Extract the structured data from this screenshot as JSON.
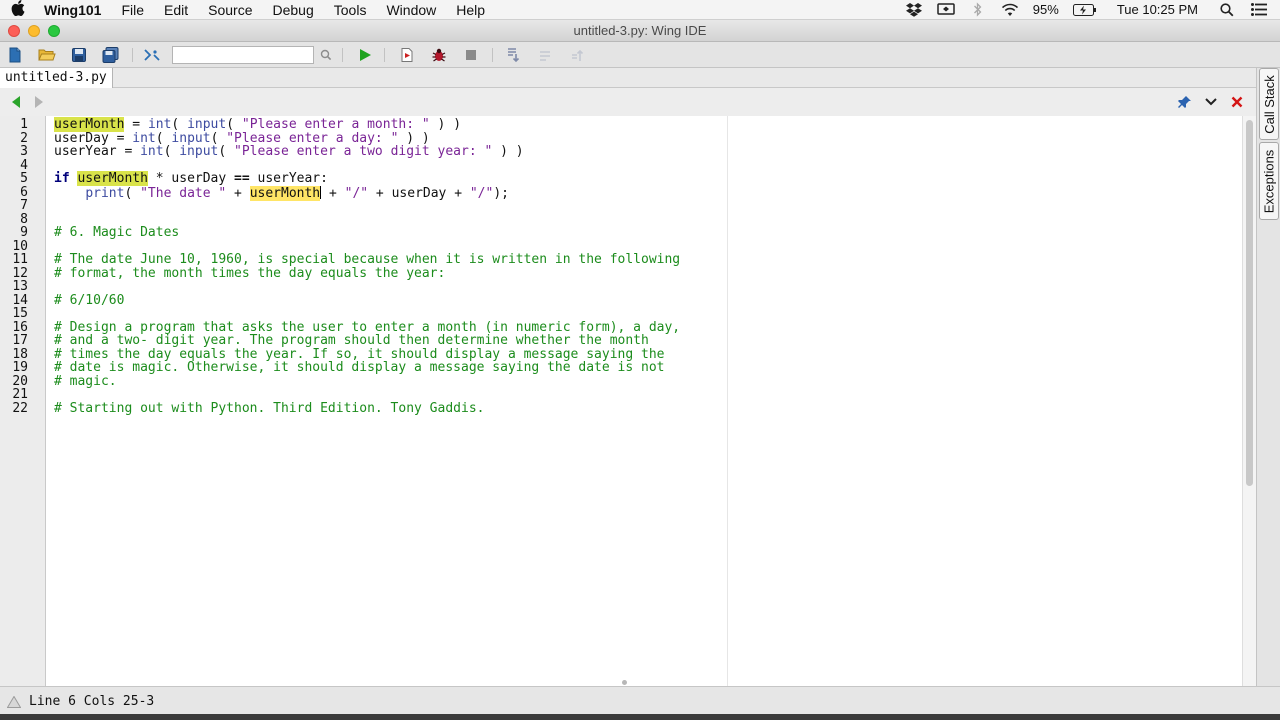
{
  "menubar": {
    "app_name": "Wing101",
    "items": [
      "File",
      "Edit",
      "Source",
      "Debug",
      "Tools",
      "Window",
      "Help"
    ],
    "battery": "95%",
    "clock": "Tue 10:25 PM"
  },
  "window": {
    "title": "untitled-3.py: Wing IDE"
  },
  "toolbar": {
    "search_value": ""
  },
  "tabs": [
    {
      "label": "untitled-3.py",
      "active": true
    }
  ],
  "side_panels": [
    "Call Stack",
    "Exceptions"
  ],
  "editor": {
    "line_numbers": [
      "1",
      "2",
      "3",
      "4",
      "5",
      "6",
      "7",
      "8",
      "9",
      "10",
      "11",
      "12",
      "13",
      "14",
      "15",
      "16",
      "17",
      "18",
      "19",
      "20",
      "21",
      "22"
    ],
    "lines": {
      "l1": {
        "a": "userMonth",
        "b": " = ",
        "c": "int",
        "d": "( ",
        "e": "input",
        "f": "( ",
        "g": "\"Please enter a month: \"",
        "h": " ) )"
      },
      "l2": {
        "a": "userDay = ",
        "b": "int",
        "c": "( ",
        "d": "input",
        "e": "( ",
        "f": "\"Please enter a day: \"",
        "g": " ) )"
      },
      "l3": {
        "a": "userYear = ",
        "b": "int",
        "c": "( ",
        "d": "input",
        "e": "( ",
        "f": "\"Please enter a two digit year: \"",
        "g": " ) )"
      },
      "l5": {
        "a": "if",
        "b": " ",
        "c": "userMonth",
        "d": " * userDay ",
        "e": "==",
        "f": " userYear:"
      },
      "l6": {
        "a": "    ",
        "b": "print",
        "c": "( ",
        "d": "\"The date \"",
        "e": " + ",
        "f": "userMonth",
        "g": " + ",
        "h": "\"/\"",
        "i": " + userDay + ",
        "j": "\"/\"",
        "k": ");"
      },
      "l9": "# 6. Magic Dates",
      "l11": "# The date June 10, 1960, is special because when it is written in the following",
      "l12": "# format, the month times the day equals the year:",
      "l14": "# 6/10/60",
      "l16": "# Design a program that asks the user to enter a month (in numeric form), a day,",
      "l17": "# and a two- digit year. The program should then determine whether the month",
      "l18": "# times the day equals the year. If so, it should display a message saying the",
      "l19": "# date is magic. Otherwise, it should display a message saying the date is not",
      "l20": "# magic.",
      "l22": "# Starting out with Python. Third Edition. Tony Gaddis."
    }
  },
  "status": {
    "position": "Line 6 Cols 25-3"
  },
  "colors": {
    "keyword": "#00007a",
    "builtin": "#3d4ba0",
    "string": "#7a2496",
    "comment": "#1c8c1c",
    "highlight": "#d9e34a"
  },
  "icons": [
    "apple-icon",
    "dropbox-icon",
    "screen-mirror-icon",
    "bluetooth-icon",
    "wifi-icon",
    "battery-icon",
    "spotlight-icon",
    "notification-list-icon",
    "new-file-icon",
    "open-folder-icon",
    "save-icon",
    "save-all-icon",
    "search-icon",
    "run-icon",
    "debug-icon",
    "bug-icon",
    "stop-icon",
    "step-into-icon",
    "step-over-icon",
    "step-out-icon",
    "back-arrow-icon",
    "forward-arrow-icon",
    "pin-icon",
    "options-chevron-icon",
    "close-icon",
    "status-warning-icon"
  ]
}
